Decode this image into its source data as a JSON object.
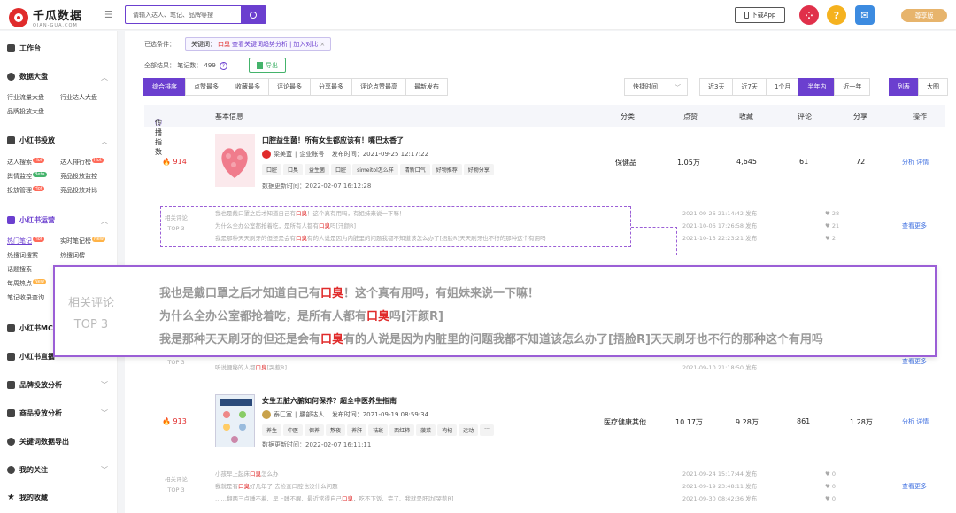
{
  "header": {
    "brand": "千瓜数据",
    "brand_sub": "QIAN-GUA.COM",
    "search_placeholder": "请输入达人、笔记、品牌等搜",
    "download_app": "下载App",
    "vip_label": "尊享版"
  },
  "sidebar": {
    "workbench": "工作台",
    "data_panel": "数据大盘",
    "data_items": [
      "行业流量大盘",
      "行业达人大盘",
      "品牌投放大盘"
    ],
    "xhs_launch": "小红书投放",
    "launch_items": [
      "达人搜索",
      "达人排行榜",
      "舆情监控",
      "竞品投放监控",
      "投放管理",
      "竞品投放对比"
    ],
    "xhs_ops": "小红书运营",
    "ops_items": [
      "热门笔记",
      "实时笔记榜",
      "热搜词搜索",
      "热搜词榜",
      "话题搜索",
      "每周热点",
      "笔记收录查询"
    ],
    "xhs_mcn": "小红书MCN",
    "xhs_live": "小红书直播",
    "brand_analysis": "品牌投放分析",
    "product_analysis": "商品投放分析",
    "keyword_export": "关键词数据导出",
    "my_follow": "我的关注",
    "my_favorites": "我的收藏",
    "badge_hot": "Hot",
    "badge_new": "New",
    "badge_beta": "Beta"
  },
  "filters": {
    "selected_label": "已选条件：",
    "chip_text": "关键词：",
    "chip_keyword": "口臭",
    "chip_link1": "查看关键词趋势分析",
    "chip_sep": "|",
    "chip_link2": "加入对比",
    "chip_close": "×",
    "total_label": "全部结果：",
    "notes_label": "笔记数：",
    "notes_count": "499",
    "export": "导出"
  },
  "sort_tabs": [
    "综合排序",
    "点赞最多",
    "收藏最多",
    "评论最多",
    "分享最多",
    "评论点赞最高",
    "最新发布"
  ],
  "quick_time": "快捷时间",
  "ranges": [
    "近3天",
    "近7天",
    "1个月",
    "半年内",
    "近一年"
  ],
  "views": [
    "列表",
    "大图"
  ],
  "table_headers": {
    "index": "传播指数",
    "info": "基本信息",
    "category": "分类",
    "likes": "点赞",
    "favorites": "收藏",
    "comments": "评论",
    "shares": "分享",
    "actions": "操作"
  },
  "posts": [
    {
      "index": "914",
      "title": "口腔益生菌！所有女生都应该有！嘴巴太香了",
      "author": "梁美蓝",
      "author_type": "企业账号",
      "publish": "发布时间：2021-09-25 12:17:22",
      "tags": [
        "口腔",
        "口臭",
        "益生菌",
        "口腔",
        "simeitol怎么样",
        "清新口气",
        "好物推荐",
        "好物分享"
      ],
      "updated": "数据更新时间：2022-02-07 16:12:28",
      "category": "保健品",
      "likes": "1.05万",
      "favorites": "4,645",
      "comments": "61",
      "shares": "72",
      "action1": "分析",
      "action2": "详情"
    },
    {
      "index": "913",
      "title": "女生五脏六腑如何保养？超全中医养生指南",
      "author": "泰匚室",
      "author_type": "腰部达人",
      "publish": "发布时间：2021-09-19 08:59:34",
      "tags": [
        "养生",
        "中医",
        "保养",
        "熬夜",
        "养肝",
        "祛斑",
        "西红柿",
        "菠菜",
        "枸杞",
        "运动",
        "···"
      ],
      "updated": "数据更新时间：2022-02-07 16:11:11",
      "category": "医疗健康其他",
      "likes": "10.17万",
      "favorites": "9.28万",
      "comments": "861",
      "shares": "1.28万",
      "action1": "分析",
      "action2": "详情"
    }
  ],
  "comments_block1": {
    "label1": "相关评论",
    "label2": "TOP 3",
    "lines": [
      [
        "我也是戴口罩之后才知道自己有",
        "口臭",
        "！这个真有用吗，有姐妹来说一下嘛！"
      ],
      [
        "为什么全办公室都抢着吃，是所有人都有",
        "口臭",
        "吗[汗颜R]"
      ],
      [
        "我是那种天天刷牙的但还是会有",
        "口臭",
        "有的人说是因为内脏里的问题我都不知道该怎么办了[捂脸R]天天刷牙也不行的那种这个有用吗"
      ]
    ],
    "dates": [
      "2021-09-26 21:14:42 发布",
      "2021-10-06 17:26:58 发布",
      "2021-10-13 22:23:21 发布"
    ],
    "likes": [
      "28",
      "21",
      "2"
    ],
    "more": "查看更多"
  },
  "comments_block2": {
    "label2": "TOP 3",
    "line": [
      "听说便秘的人都",
      "口臭",
      "[哭惹R]"
    ],
    "date": "2021-09-10 21:18:50 发布",
    "more": "查看更多"
  },
  "comments_block3": {
    "label1": "相关评论",
    "label2": "TOP 3",
    "lines": [
      [
        "小孩早上起床",
        "口臭",
        "怎么办"
      ],
      [
        "我就是有",
        "口臭",
        "好几年了 去检查口腔也没什么问题"
      ],
      [
        "……翻两三点睡不着、早上睡不醒、最近常得自己",
        "口臭",
        "，吃不下饭、完了、我就是肝功[哭惹R]"
      ]
    ],
    "dates": [
      "2021-09-24 15:17:44 发布",
      "2021-09-19 23:48:11 发布",
      "2021-09-30 08:42:36 发布"
    ],
    "likes": [
      "0",
      "0",
      "0"
    ],
    "more": "查看更多"
  },
  "zoom": {
    "label1": "相关评论",
    "label2": "TOP 3"
  }
}
